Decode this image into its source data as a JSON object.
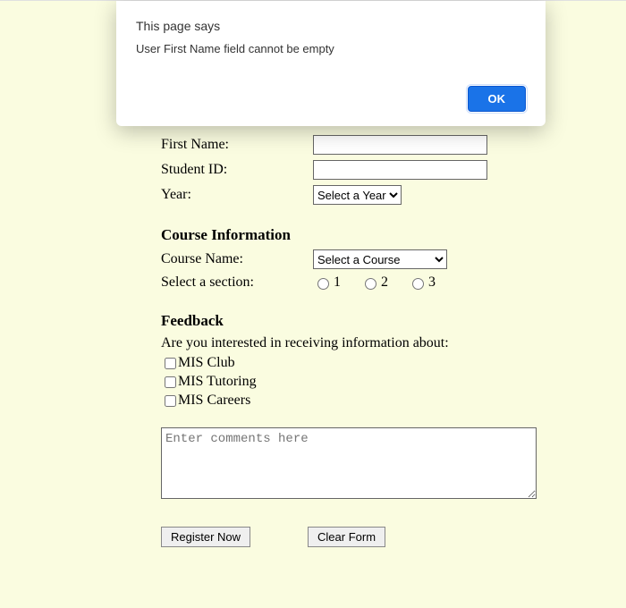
{
  "alert": {
    "title": "This page says",
    "message": "User First Name field cannot be empty",
    "ok": "OK"
  },
  "student": {
    "first_name_label": "First Name:",
    "student_id_label": "Student ID:",
    "year_label": "Year:",
    "year_placeholder": "Select a Year",
    "first_name_value": "",
    "student_id_value": ""
  },
  "course": {
    "heading": "Course Information",
    "name_label": "Course Name:",
    "name_placeholder": "Select a Course",
    "section_label": "Select a section:",
    "sections": [
      "1",
      "2",
      "3"
    ]
  },
  "feedback": {
    "heading": "Feedback",
    "question": "Are you interested in receiving information about:",
    "options": [
      "MIS Club",
      "MIS Tutoring",
      "MIS Careers"
    ],
    "comments_placeholder": "Enter comments here"
  },
  "buttons": {
    "register": "Register Now",
    "clear": "Clear Form"
  }
}
